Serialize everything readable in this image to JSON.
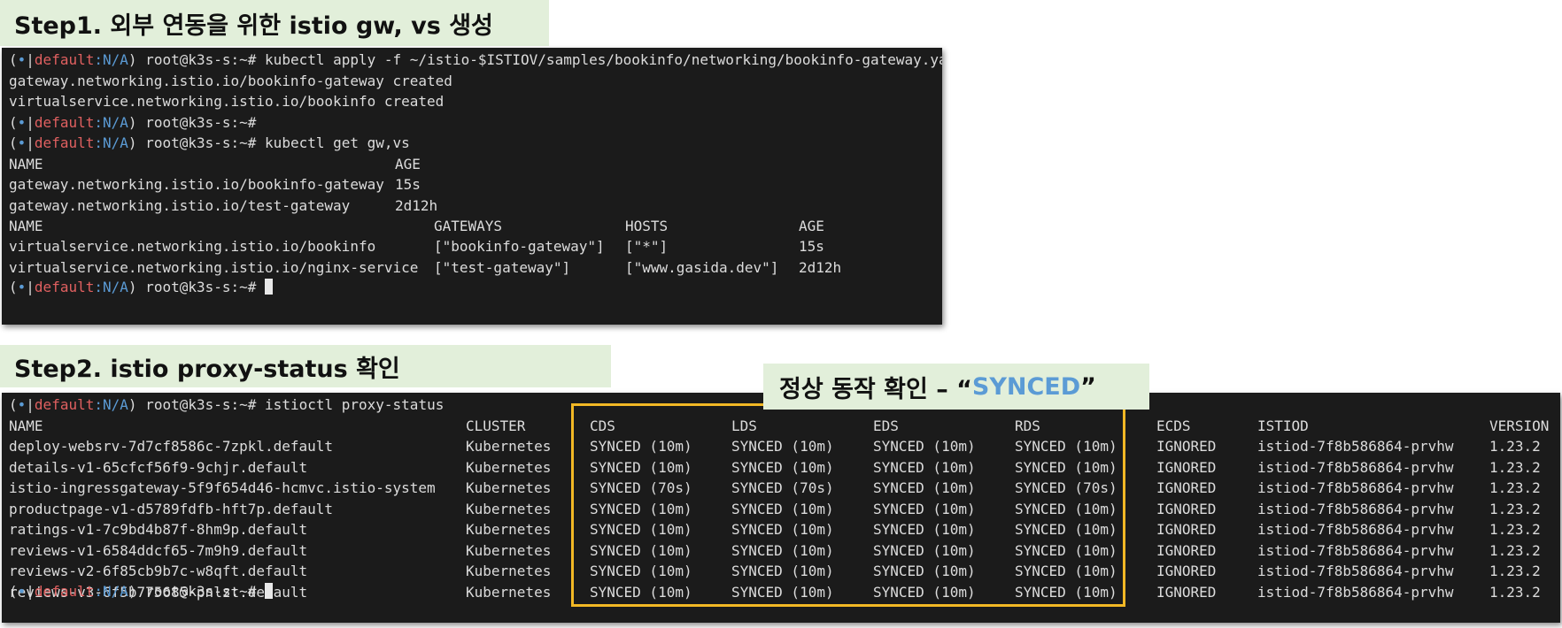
{
  "step1": {
    "label": "Step1. 외부 연동을 위한 istio gw, vs 생성"
  },
  "step2": {
    "label": "Step2. istio proxy-status 확인"
  },
  "callout": {
    "prefix": "정상 동작 확인 – “",
    "highlight": "SYNCED",
    "suffix": "”"
  },
  "prompt": {
    "open": "(",
    "dot": "•",
    "bar": "|",
    "context": "default",
    "sep": ":",
    "namespace": "N/A",
    "close": ")",
    "user": " root@k3s-s:~# "
  },
  "term1": {
    "cmd_apply": "kubectl apply -f ~/istio-$ISTIOV/samples/bookinfo/networking/bookinfo-gateway.yaml",
    "out_gw_created": "gateway.networking.istio.io/bookinfo-gateway created",
    "out_vs_created": "virtualservice.networking.istio.io/bookinfo created",
    "cmd_get": "kubectl get gw,vs",
    "gw_headers": [
      "NAME",
      "AGE"
    ],
    "gw_rows": [
      [
        "gateway.networking.istio.io/bookinfo-gateway",
        "15s"
      ],
      [
        "gateway.networking.istio.io/test-gateway",
        "2d12h"
      ]
    ],
    "vs_headers": [
      "NAME",
      "GATEWAYS",
      "HOSTS",
      "AGE"
    ],
    "vs_rows": [
      [
        "virtualservice.networking.istio.io/bookinfo",
        "[\"bookinfo-gateway\"]",
        "[\"*\"]",
        "15s"
      ],
      [
        "virtualservice.networking.istio.io/nginx-service",
        "[\"test-gateway\"]",
        "[\"www.gasida.dev\"]",
        "2d12h"
      ]
    ]
  },
  "term2": {
    "cmd": "istioctl proxy-status",
    "headers": [
      "NAME",
      "CLUSTER",
      "CDS",
      "LDS",
      "EDS",
      "RDS",
      "ECDS",
      "ISTIOD",
      "VERSION"
    ],
    "rows": [
      [
        "deploy-websrv-7d7cf8586c-7zpkl.default",
        "Kubernetes",
        "SYNCED (10m)",
        "SYNCED (10m)",
        "SYNCED (10m)",
        "SYNCED (10m)",
        "IGNORED",
        "istiod-7f8b586864-prvhw",
        "1.23.2"
      ],
      [
        "details-v1-65cfcf56f9-9chjr.default",
        "Kubernetes",
        "SYNCED (10m)",
        "SYNCED (10m)",
        "SYNCED (10m)",
        "SYNCED (10m)",
        "IGNORED",
        "istiod-7f8b586864-prvhw",
        "1.23.2"
      ],
      [
        "istio-ingressgateway-5f9f654d46-hcmvc.istio-system",
        "Kubernetes",
        "SYNCED (70s)",
        "SYNCED (70s)",
        "SYNCED (10m)",
        "SYNCED (70s)",
        "IGNORED",
        "istiod-7f8b586864-prvhw",
        "1.23.2"
      ],
      [
        "productpage-v1-d5789fdfb-hft7p.default",
        "Kubernetes",
        "SYNCED (10m)",
        "SYNCED (10m)",
        "SYNCED (10m)",
        "SYNCED (10m)",
        "IGNORED",
        "istiod-7f8b586864-prvhw",
        "1.23.2"
      ],
      [
        "ratings-v1-7c9bd4b87f-8hm9p.default",
        "Kubernetes",
        "SYNCED (10m)",
        "SYNCED (10m)",
        "SYNCED (10m)",
        "SYNCED (10m)",
        "IGNORED",
        "istiod-7f8b586864-prvhw",
        "1.23.2"
      ],
      [
        "reviews-v1-6584ddcf65-7m9h9.default",
        "Kubernetes",
        "SYNCED (10m)",
        "SYNCED (10m)",
        "SYNCED (10m)",
        "SYNCED (10m)",
        "IGNORED",
        "istiod-7f8b586864-prvhw",
        "1.23.2"
      ],
      [
        "reviews-v2-6f85cb9b7c-w8qft.default",
        "Kubernetes",
        "SYNCED (10m)",
        "SYNCED (10m)",
        "SYNCED (10m)",
        "SYNCED (10m)",
        "IGNORED",
        "istiod-7f8b586864-prvhw",
        "1.23.2"
      ],
      [
        "reviews-v3-6f5b775685-pnlzt.default",
        "Kubernetes",
        "SYNCED (10m)",
        "SYNCED (10m)",
        "SYNCED (10m)",
        "SYNCED (10m)",
        "IGNORED",
        "istiod-7f8b586864-prvhw",
        "1.23.2"
      ]
    ]
  },
  "colors": {
    "accent_blue": "#5b9bd5",
    "context_red": "#e06060",
    "highlight_border": "#f2b825",
    "label_bg": "#e2efda",
    "terminal_bg": "#1b1b1b"
  }
}
